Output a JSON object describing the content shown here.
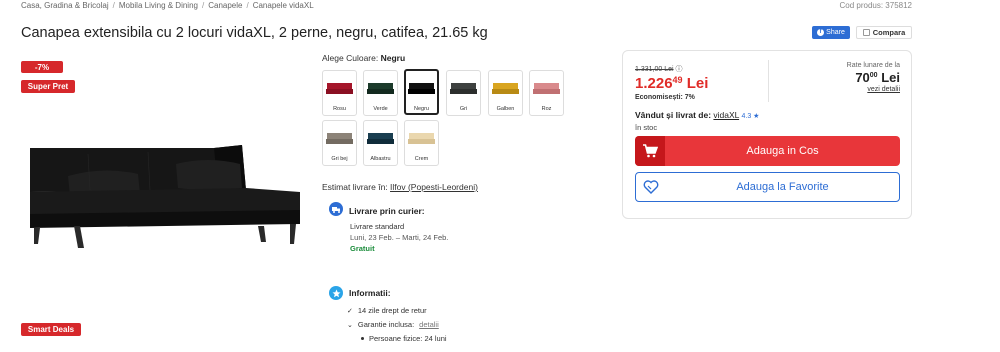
{
  "breadcrumb": [
    "Casa, Gradina & Bricolaj",
    "Mobila Living & Dining",
    "Canapele",
    "Canapele vidaXL"
  ],
  "product_code": "Cod produs: 375812",
  "title": "Canapea extensibila cu 2 locuri vidaXL, 2 perne, negru, catifea, 21.65 kg",
  "actions": {
    "share": "Share",
    "compare": "Compara"
  },
  "badges": {
    "discount": "-7%",
    "super_price": "Super Pret",
    "smart_deals": "Smart Deals"
  },
  "color_section": {
    "label": "Alege Culoare:",
    "selected": "Negru",
    "swatches": [
      {
        "name": "Rosu",
        "color": "#a5152a"
      },
      {
        "name": "Verde",
        "color": "#1c3b2b"
      },
      {
        "name": "Negru",
        "color": "#111111"
      },
      {
        "name": "Gri",
        "color": "#3e4140"
      },
      {
        "name": "Galben",
        "color": "#d9a520"
      },
      {
        "name": "Roz",
        "color": "#d98a8c"
      },
      {
        "name": "Gri bej",
        "color": "#8c8378"
      },
      {
        "name": "Albastru",
        "color": "#1a3e50"
      },
      {
        "name": "Crem",
        "color": "#ead7ae"
      }
    ]
  },
  "delivery": {
    "estimate_label": "Estimat livrare în:",
    "location": "Ilfov (Popesti-Leordeni)",
    "courier_title": "Livrare prin curier:",
    "standard": "Livrare standard",
    "dates": "Luni, 23 Feb. – Marti, 24 Feb.",
    "cost": "Gratuit"
  },
  "info": {
    "title": "Informatii:",
    "return": "14 zile drept de retur",
    "warranty": "Garantie inclusa:",
    "warranty_link": "detalii",
    "persons": "Persoane fizice: 24 luni"
  },
  "pricing": {
    "old_price": "1.331,00 Lei",
    "price_int": "1.226",
    "price_dec": "49",
    "currency": "Lei",
    "savings": "Economisești: 7%",
    "rate_label": "Rate lunare de la",
    "rate_int": "70",
    "rate_dec": "00",
    "rate_link": "vezi detalii"
  },
  "seller": {
    "label": "Vândut și livrat de:",
    "vendor": "vidaXL",
    "rating": "4.3 ★",
    "stock": "în stoc"
  },
  "buttons": {
    "add_to_cart": "Adauga in Cos",
    "add_to_favorites": "Adauga la Favorite"
  },
  "colors": {
    "accent": "#2d6dd4",
    "price_red": "#e02b27",
    "cart_red": "#e8363a",
    "badge_red": "#d6282b",
    "free_green": "#1a8c3a"
  }
}
